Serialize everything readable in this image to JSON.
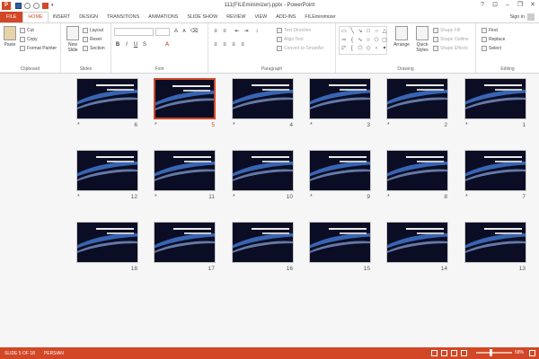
{
  "titlebar": {
    "app_icon": "P",
    "title": "111(FILEminimizer).pptx - PowerPoint",
    "help": "?"
  },
  "tabs": [
    "FILE",
    "HOME",
    "INSERT",
    "DESIGN",
    "TRANSITIONS",
    "ANIMATIONS",
    "SLIDE SHOW",
    "REVIEW",
    "VIEW",
    "ADD-INS",
    "FILEminimizer"
  ],
  "signin": "Sign in",
  "ribbon": {
    "clipboard": {
      "paste": "Paste",
      "cut": "Cut",
      "copy": "Copy",
      "format_painter": "Format Painter",
      "label": "Clipboard"
    },
    "slides": {
      "new_slide": "New",
      "new_slide2": "Slide",
      "layout": "Layout",
      "reset": "Reset",
      "section": "Section",
      "label": "Slides"
    },
    "font": {
      "label": "Font",
      "bold": "B",
      "italic": "I",
      "underline": "U",
      "strike": "S",
      "grow": "A",
      "shrink": "A"
    },
    "paragraph": {
      "text_direction": "Text Direction",
      "align_text": "Align Text",
      "convert_smartart": "Convert to SmartArt",
      "label": "Paragraph"
    },
    "drawing": {
      "arrange": "Arrange",
      "quick_styles": "Quick",
      "quick_styles2": "Styles",
      "shape_fill": "Shape Fill",
      "shape_outline": "Shape Outline",
      "shape_effects": "Shape Effects",
      "label": "Drawing"
    },
    "editing": {
      "find": "Find",
      "replace": "Replace",
      "select": "Select",
      "label": "Editing"
    }
  },
  "slides": [
    {
      "n": "1",
      "star": "*"
    },
    {
      "n": "2",
      "star": "*"
    },
    {
      "n": "3",
      "star": "*"
    },
    {
      "n": "4",
      "star": "*"
    },
    {
      "n": "5",
      "star": "*"
    },
    {
      "n": "6",
      "star": "*"
    },
    {
      "n": "7",
      "star": "*"
    },
    {
      "n": "8",
      "star": "*"
    },
    {
      "n": "9",
      "star": "*"
    },
    {
      "n": "10",
      "star": "*"
    },
    {
      "n": "11",
      "star": "*"
    },
    {
      "n": "12",
      "star": "*"
    },
    {
      "n": "13",
      "star": ""
    },
    {
      "n": "14",
      "star": ""
    },
    {
      "n": "15",
      "star": ""
    },
    {
      "n": "16",
      "star": ""
    },
    {
      "n": "17",
      "star": ""
    },
    {
      "n": "18",
      "star": ""
    }
  ],
  "selected_slide": "5",
  "status": {
    "slide": "SLIDE 5 OF 18",
    "language": "PERSIAN",
    "zoom": "58%"
  },
  "colors": {
    "accent": "#d24726"
  }
}
